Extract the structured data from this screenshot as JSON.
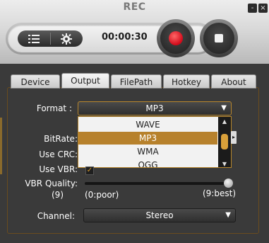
{
  "window": {
    "title": "REC",
    "minimize_label": "-",
    "close_label": "×"
  },
  "controls": {
    "timer": "00:00:30",
    "record_label": "",
    "stop_label": ""
  },
  "tabs": [
    {
      "label": "Device"
    },
    {
      "label": "Output"
    },
    {
      "label": "FilePath"
    },
    {
      "label": "Hotkey"
    },
    {
      "label": "About"
    }
  ],
  "form": {
    "format_label": "Format :",
    "format_value": "MP3",
    "format_options": [
      "WAVE",
      "MP3",
      "WMA",
      "OGG"
    ],
    "bitrate_label": "BitRate:",
    "use_crc_label": "Use CRC:",
    "use_vbr_label": "Use VBR:",
    "use_vbr_checked": true,
    "vbr_quality_label": "VBR Quality:",
    "vbr_quality_value": "(9)",
    "vbr_min_label": "(0:poor)",
    "vbr_max_label": "(9:best)",
    "vbr_quality_level": 9,
    "channel_label": "Channel:",
    "channel_value": "Stereo"
  },
  "colors": {
    "accent": "#b7812c",
    "record": "#d10a1a"
  },
  "icons": {
    "list": "list-icon",
    "settings": "gear-icon",
    "record": "record-icon",
    "stop": "stop-icon",
    "chevron": "chevron-down-icon"
  }
}
